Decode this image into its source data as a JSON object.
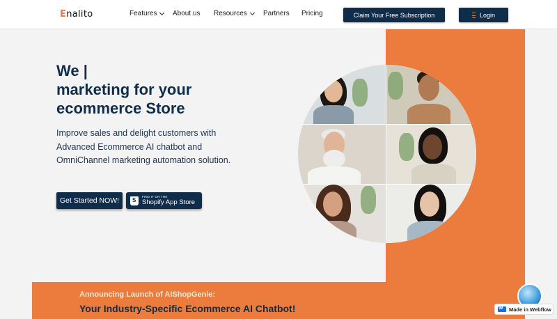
{
  "nav": {
    "logo_initial": "E",
    "logo_rest": "nalito",
    "items": [
      {
        "label": "Features",
        "dropdown": true
      },
      {
        "label": "About us",
        "dropdown": false
      },
      {
        "label": "Resources",
        "dropdown": true
      },
      {
        "label": "Partners",
        "dropdown": false
      },
      {
        "label": "Pricing",
        "dropdown": false
      }
    ],
    "claim_label": "Claim Your Free Subscription",
    "login_label": "Login"
  },
  "hero": {
    "headline_line1": "We |",
    "headline_line2": "marketing for your",
    "headline_line3": "ecommerce Store",
    "subtext": "Improve sales and delight customers with Advanced Ecommerce AI chatbot and OmniChannel marketing automation solution.",
    "cta_label": "Get Started NOW!",
    "shopify_small": "FIND IT ON THE",
    "shopify_big": "Shopify App Store"
  },
  "announcement": {
    "line1": "Announcing Launch of AIShopGenie:",
    "line2": "Your Industry-Specific Ecommerce AI Chatbot!"
  },
  "badge": {
    "label": "Made in Webflow"
  },
  "colors": {
    "navy": "#0f2d4a",
    "orange": "#ec7c3e",
    "background": "#f4f3f3"
  }
}
